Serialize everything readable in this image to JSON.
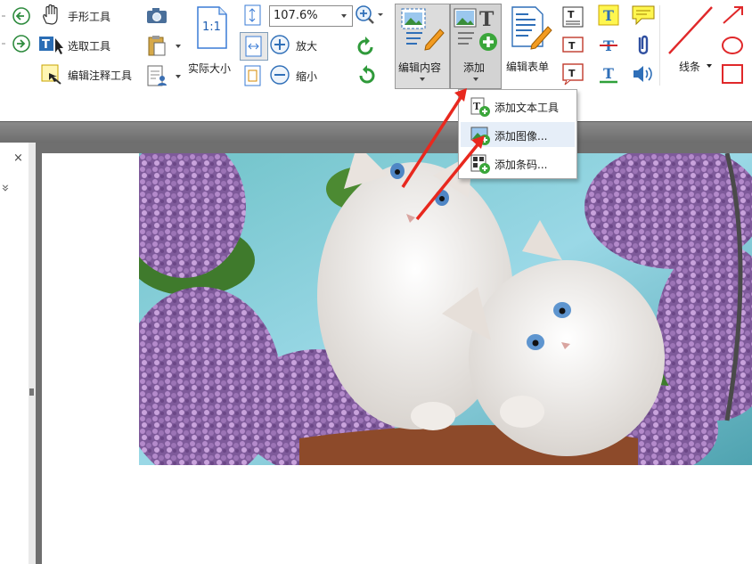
{
  "toolbar": {
    "hand_tool": "手形工具",
    "select_tool": "选取工具",
    "edit_annot_tool": "编辑注释工具",
    "actual_size": "实际大小",
    "actual_size_icon_text": "1:1",
    "zoom_value": "107.6%",
    "zoom_in": "放大",
    "zoom_out": "缩小",
    "edit_content": "编辑内容",
    "add": "添加",
    "edit_form": "编辑表单",
    "lines": "线条"
  },
  "add_menu": {
    "items": [
      {
        "label": "添加文本工具"
      },
      {
        "label": "添加图像..."
      },
      {
        "label": "添加条码..."
      }
    ]
  },
  "panel": {
    "close_glyph": "×",
    "collapse_glyph": "»"
  },
  "colors": {
    "annotation_arrow": "#e8281e",
    "ribbon_bg": "#ffffff",
    "doc_bg": "#6f6f6f"
  }
}
